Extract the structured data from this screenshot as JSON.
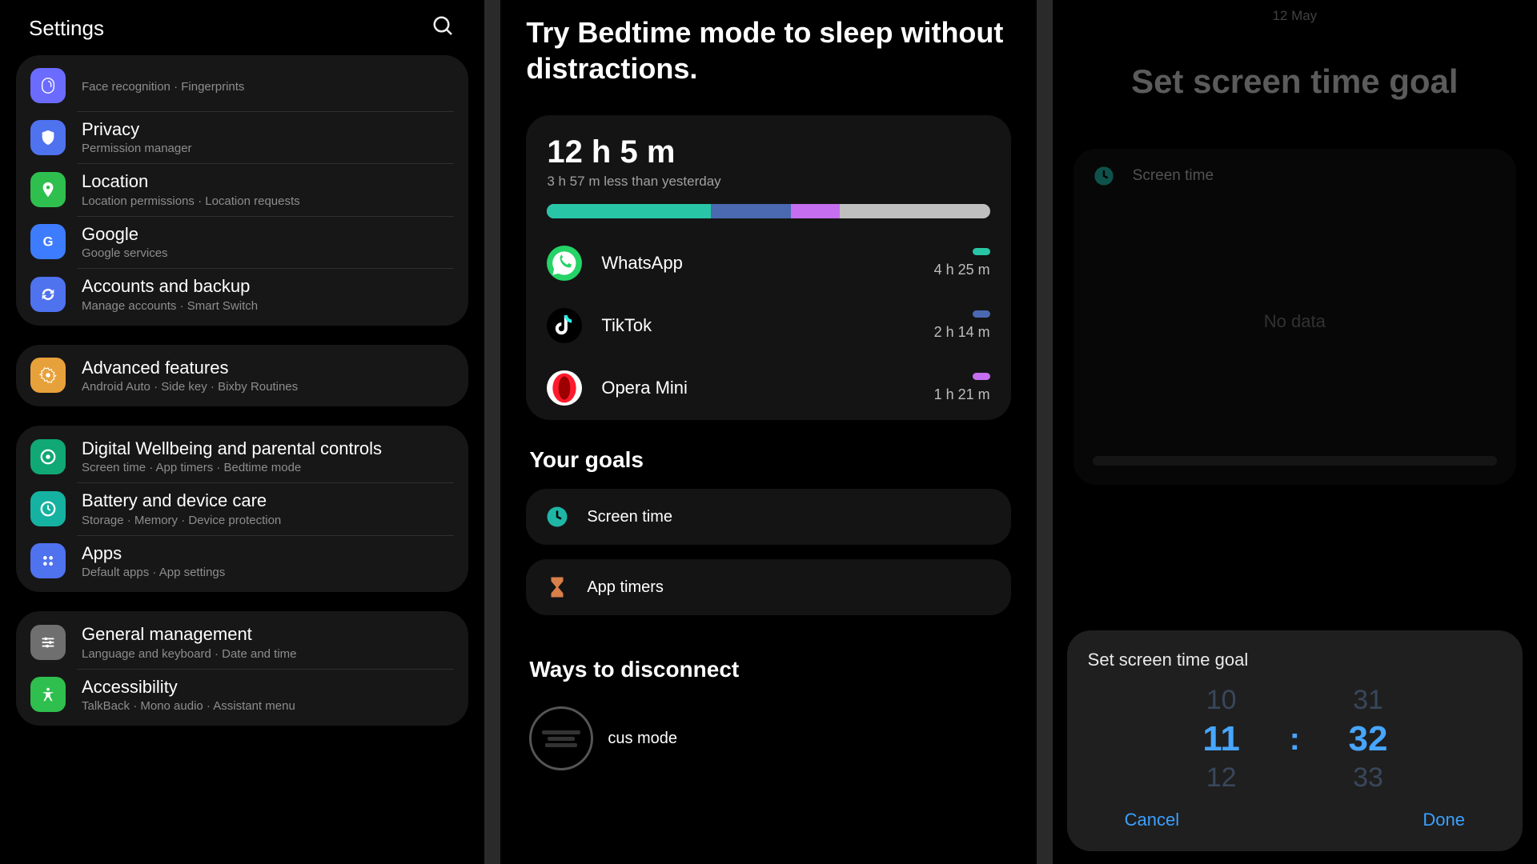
{
  "panel1": {
    "title": "Settings",
    "groups": [
      [
        {
          "title": "",
          "sub": "Face recognition  ·  Fingerprints",
          "color": "#6b6cff",
          "icon": "fingerprint"
        },
        {
          "title": "Privacy",
          "sub": "Permission manager",
          "color": "#4f72ef",
          "icon": "shield"
        },
        {
          "title": "Location",
          "sub": "Location permissions  ·  Location requests",
          "color": "#2fbf4e",
          "icon": "pin"
        },
        {
          "title": "Google",
          "sub": "Google services",
          "color": "#3e7cff",
          "icon": "google"
        },
        {
          "title": "Accounts and backup",
          "sub": "Manage accounts  ·  Smart Switch",
          "color": "#4f72ef",
          "icon": "sync"
        }
      ],
      [
        {
          "title": "Advanced features",
          "sub": "Android Auto  ·  Side key  ·  Bixby Routines",
          "color": "#e7a13b",
          "icon": "gear"
        }
      ],
      [
        {
          "title": "Digital Wellbeing and parental controls",
          "sub": "Screen time  ·  App timers  ·  Bedtime mode",
          "color": "#10a874",
          "icon": "wellbeing"
        },
        {
          "title": "Battery and device care",
          "sub": "Storage  ·  Memory  ·  Device protection",
          "color": "#16b2a1",
          "icon": "care"
        },
        {
          "title": "Apps",
          "sub": "Default apps  ·  App settings",
          "color": "#4f72ef",
          "icon": "apps"
        }
      ],
      [
        {
          "title": "General management",
          "sub": "Language and keyboard  ·  Date and time",
          "color": "#6f6f6f",
          "icon": "sliders"
        },
        {
          "title": "Accessibility",
          "sub": "TalkBack  ·  Mono audio  ·  Assistant menu",
          "color": "#2fbf4e",
          "icon": "a11y"
        }
      ]
    ]
  },
  "panel2": {
    "headline": "Try Bedtime mode to sleep without distractions.",
    "total": "12 h 5 m",
    "delta": "3 h 57 m less than yesterday",
    "apps": [
      {
        "name": "WhatsApp",
        "time": "4 h 25 m",
        "chip": "#28c6a6",
        "bg": "#25d366",
        "icon": "whatsapp"
      },
      {
        "name": "TikTok",
        "time": "2 h 14 m",
        "chip": "#4a69b0",
        "bg": "#000",
        "icon": "tiktok"
      },
      {
        "name": "Opera Mini",
        "time": "1 h 21 m",
        "chip": "#c56ff0",
        "bg": "#ff1b2d",
        "icon": "opera"
      }
    ],
    "goals_head": "Your goals",
    "goal1": "Screen time",
    "goal2": "App timers",
    "ways_head": "Ways to disconnect",
    "focus": "cus mode"
  },
  "panel3": {
    "date": "12 May",
    "title": "Set screen time goal",
    "card_label": "Screen time",
    "no_data": "No data",
    "sheet_title": "Set screen time goal",
    "hours": {
      "prev": "10",
      "sel": "11",
      "next": "12"
    },
    "minutes": {
      "prev": "31",
      "sel": "32",
      "next": "33"
    },
    "cancel": "Cancel",
    "done": "Done"
  }
}
